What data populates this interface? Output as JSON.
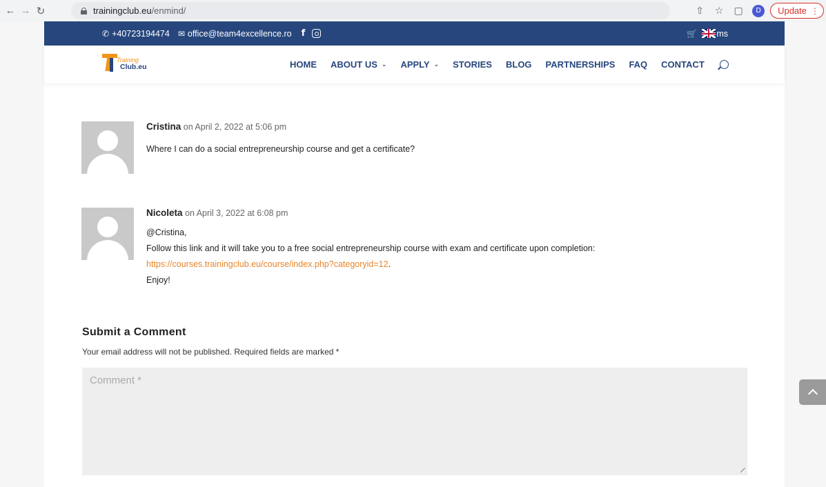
{
  "browser": {
    "url_host": "trainingclub.eu",
    "url_path": "/enmind/",
    "profile_initial": "D",
    "update_label": "Update"
  },
  "topbar": {
    "phone": "+40723194474",
    "email": "office@team4excellence.ro",
    "facebook": "f",
    "language": "ms",
    "color": "#27467d"
  },
  "header": {
    "logo_line1": "Training",
    "logo_line2": "Club.eu",
    "menu": [
      {
        "label": "HOME"
      },
      {
        "label": "ABOUT US"
      },
      {
        "label": "APPLY"
      },
      {
        "label": "STORIES"
      },
      {
        "label": "BLOG"
      },
      {
        "label": "PARTNERSHIPS"
      },
      {
        "label": "FAQ"
      },
      {
        "label": "CONTACT"
      }
    ]
  },
  "comments": [
    {
      "author": "Cristina",
      "date": "on April 2, 2022 at 5:06 pm",
      "text": "Where I can do a social entrepreneurship course and get a certificate?"
    },
    {
      "author": "Nicoleta",
      "date": "on April 3, 2022 at 6:08 pm",
      "line1": "@Cristina,",
      "line2": "Follow this link and it will take you to a free social entrepreneurship course with exam and certificate upon completion:",
      "link": "https://courses.trainingclub.eu/course/index.php?categoryid=12",
      "link_suffix": ".",
      "line4": "Enjoy!"
    }
  ],
  "form": {
    "title": "Submit a Comment",
    "note": "Your email address will not be published. Required fields are marked *",
    "comment_placeholder": "Comment *"
  },
  "colors": {
    "accent": "#e8842a",
    "brand": "#27467d"
  }
}
